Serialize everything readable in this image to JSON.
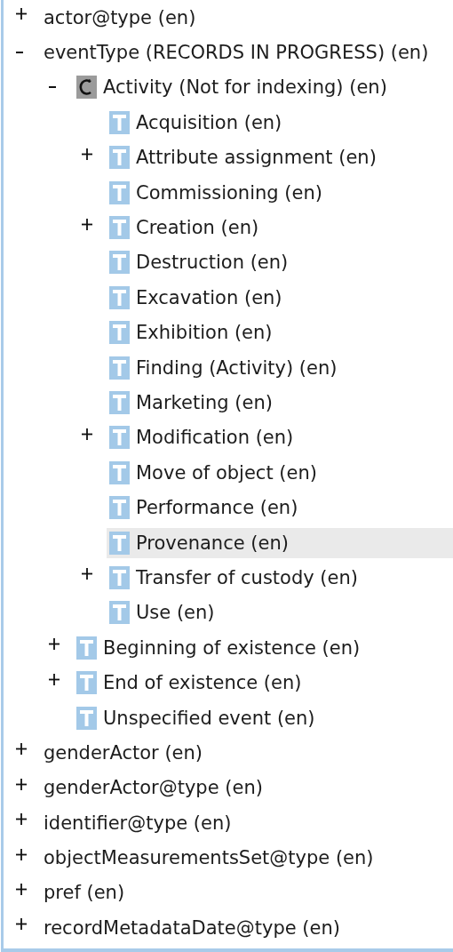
{
  "tree": [
    {
      "label": "actor@type (en)",
      "expanded": false,
      "selected": false
    },
    {
      "label": "eventType (RECORDS IN PROGRESS) (en)",
      "expanded": true,
      "selected": false,
      "children": [
        {
          "label": "Activity (Not for indexing) (en)",
          "kind": "concept",
          "expanded": true,
          "selected": false,
          "children": [
            {
              "label": "Acquisition (en)",
              "kind": "term",
              "selected": false
            },
            {
              "label": "Attribute assignment (en)",
              "kind": "term",
              "expanded": false,
              "selected": false
            },
            {
              "label": "Commissioning (en)",
              "kind": "term",
              "selected": false
            },
            {
              "label": "Creation (en)",
              "kind": "term",
              "expanded": false,
              "selected": false
            },
            {
              "label": "Destruction (en)",
              "kind": "term",
              "selected": false
            },
            {
              "label": "Excavation (en)",
              "kind": "term",
              "selected": false
            },
            {
              "label": "Exhibition (en)",
              "kind": "term",
              "selected": false
            },
            {
              "label": "Finding (Activity) (en)",
              "kind": "term",
              "selected": false
            },
            {
              "label": "Marketing (en)",
              "kind": "term",
              "selected": false
            },
            {
              "label": "Modification (en)",
              "kind": "term",
              "expanded": false,
              "selected": false
            },
            {
              "label": "Move of object (en)",
              "kind": "term",
              "selected": false
            },
            {
              "label": "Performance (en)",
              "kind": "term",
              "selected": false
            },
            {
              "label": "Provenance (en)",
              "kind": "term",
              "selected": true
            },
            {
              "label": "Transfer of custody (en)",
              "kind": "term",
              "expanded": false,
              "selected": false
            },
            {
              "label": "Use (en)",
              "kind": "term",
              "selected": false
            }
          ]
        },
        {
          "label": "Beginning of existence (en)",
          "kind": "term",
          "expanded": false,
          "selected": false
        },
        {
          "label": "End of existence (en)",
          "kind": "term",
          "expanded": false,
          "selected": false
        },
        {
          "label": "Unspecified event (en)",
          "kind": "term",
          "selected": false
        }
      ]
    },
    {
      "label": "genderActor (en)",
      "expanded": false,
      "selected": false
    },
    {
      "label": "genderActor@type (en)",
      "expanded": false,
      "selected": false
    },
    {
      "label": "identifier@type (en)",
      "expanded": false,
      "selected": false
    },
    {
      "label": "objectMeasurementsSet@type (en)",
      "expanded": false,
      "selected": false
    },
    {
      "label": "pref (en)",
      "expanded": false,
      "selected": false
    },
    {
      "label": "recordMetadataDate@type (en)",
      "expanded": false,
      "selected": false
    }
  ]
}
